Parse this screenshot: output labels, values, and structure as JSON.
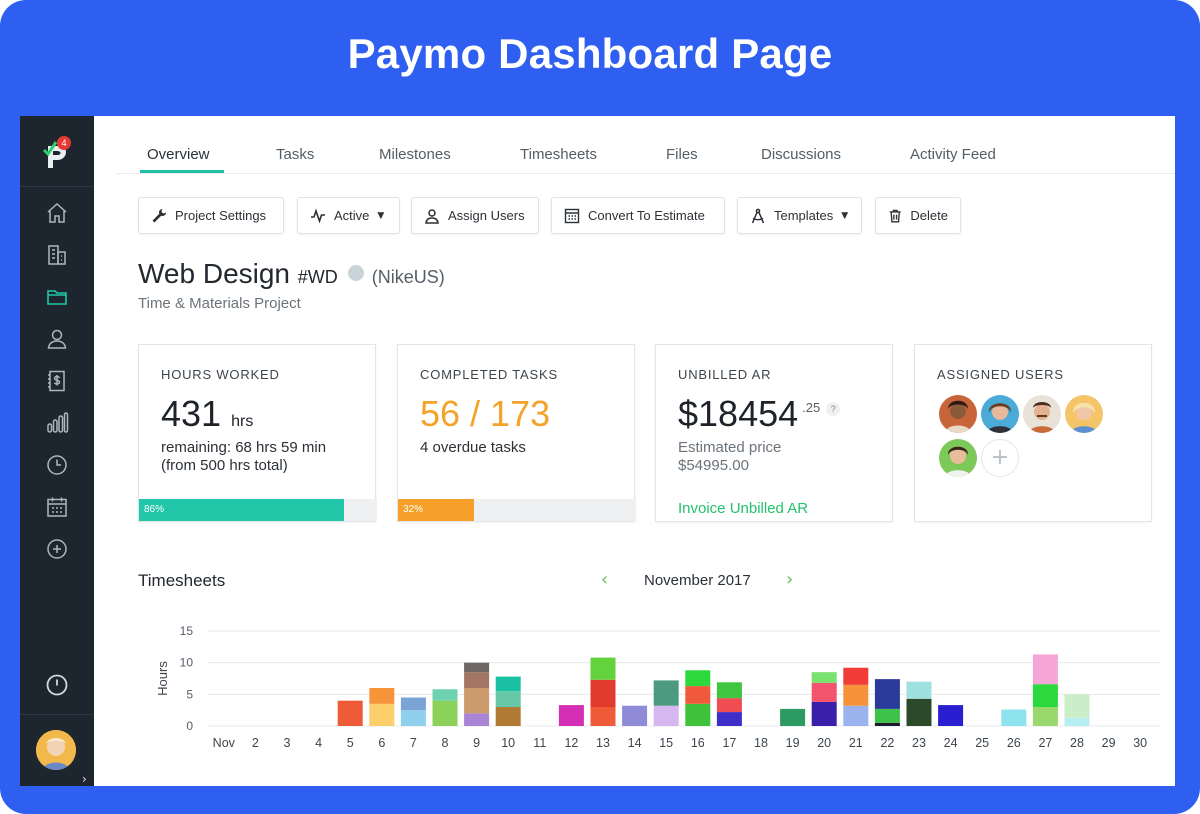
{
  "banner": {
    "title": "Paymo Dashboard Page"
  },
  "sidebar": {
    "badge_count": "4",
    "items": [
      {
        "name": "home-icon"
      },
      {
        "name": "clients-icon"
      },
      {
        "name": "projects-icon"
      },
      {
        "name": "users-icon"
      },
      {
        "name": "invoices-icon"
      },
      {
        "name": "reports-icon"
      },
      {
        "name": "time-icon"
      },
      {
        "name": "calendar-icon"
      },
      {
        "name": "add-icon"
      }
    ],
    "bottom_icon": "power-icon",
    "expand_label": "›"
  },
  "tabs": [
    {
      "label": "Overview",
      "active": true
    },
    {
      "label": "Tasks"
    },
    {
      "label": "Milestones"
    },
    {
      "label": "Timesheets"
    },
    {
      "label": "Files"
    },
    {
      "label": "Discussions"
    },
    {
      "label": "Activity Feed"
    }
  ],
  "toolbar": {
    "project_settings": "Project Settings",
    "active": "Active",
    "assign_users": "Assign Users",
    "convert_to_estimate": "Convert To Estimate",
    "templates": "Templates",
    "delete": "Delete"
  },
  "project": {
    "name": "Web Design",
    "code": "#WD",
    "client": "(NikeUS)",
    "type": "Time & Materials Project"
  },
  "cards": {
    "hours": {
      "label": "HOURS WORKED",
      "value": "431",
      "unit": "hrs",
      "remaining": "remaining: 68 hrs 59 min",
      "total": "(from 500 hrs total)",
      "progress_label": "86%",
      "progress": 0.86,
      "color": "#22c7a9"
    },
    "tasks": {
      "label": "COMPLETED TASKS",
      "value": "56 / 173",
      "overdue": "4 overdue tasks",
      "progress_label": "32%",
      "progress": 0.32,
      "color": "#f6a02a"
    },
    "unbilled": {
      "label": "UNBILLED AR",
      "value": "$18454",
      "cents": ".25",
      "help": "?",
      "estimated_label": "Estimated price",
      "estimated_value": "$54995.00",
      "link": "Invoice Unbilled AR"
    },
    "users": {
      "label": "ASSIGNED USERS",
      "add": "+"
    }
  },
  "timesheets": {
    "title": "Timesheets",
    "month": "November 2017",
    "prev": "‹",
    "next": "›"
  },
  "chart_data": {
    "type": "bar",
    "stacked": true,
    "ylabel": "Hours",
    "ylim": [
      0,
      15
    ],
    "yticks": [
      0,
      5,
      10,
      15
    ],
    "categories": [
      "Nov",
      "2",
      "3",
      "4",
      "5",
      "6",
      "7",
      "8",
      "9",
      "10",
      "11",
      "12",
      "13",
      "14",
      "15",
      "16",
      "17",
      "18",
      "19",
      "20",
      "21",
      "22",
      "23",
      "24",
      "25",
      "26",
      "27",
      "28",
      "29",
      "30"
    ],
    "stacks": [
      [],
      [],
      [],
      [],
      [
        {
          "v": 4,
          "c": "#ef5a38"
        }
      ],
      [
        {
          "v": 3.5,
          "c": "#fccf6b"
        },
        {
          "v": 2.5,
          "c": "#f7943a"
        }
      ],
      [
        {
          "v": 2.5,
          "c": "#8fd0ec"
        },
        {
          "v": 2,
          "c": "#7ba4d6"
        }
      ],
      [
        {
          "v": 4,
          "c": "#8cd25a"
        },
        {
          "v": 1.8,
          "c": "#6ed1b0"
        }
      ],
      [
        {
          "v": 2,
          "c": "#a983d6"
        },
        {
          "v": 4,
          "c": "#cd9a6b"
        },
        {
          "v": 2.5,
          "c": "#a27663"
        },
        {
          "v": 1.5,
          "c": "#6d6766"
        }
      ],
      [
        {
          "v": 3,
          "c": "#b07a34"
        },
        {
          "v": 2.5,
          "c": "#66c8a6"
        },
        {
          "v": 2.3,
          "c": "#19c0a4"
        }
      ],
      [],
      [
        {
          "v": 3.3,
          "c": "#d42fb4"
        }
      ],
      [
        {
          "v": 3,
          "c": "#ef5a38"
        },
        {
          "v": 4.3,
          "c": "#e03b2c"
        },
        {
          "v": 3.5,
          "c": "#64d23d"
        }
      ],
      [
        {
          "v": 3.2,
          "c": "#8f8bd6"
        }
      ],
      [
        {
          "v": 3.2,
          "c": "#d6b7f0"
        },
        {
          "v": 4,
          "c": "#4c9a80"
        }
      ],
      [
        {
          "v": 3.5,
          "c": "#40c33a"
        },
        {
          "v": 2.8,
          "c": "#f05a3a"
        },
        {
          "v": 2.5,
          "c": "#2bd93c"
        }
      ],
      [
        {
          "v": 2.2,
          "c": "#3e2fcb"
        },
        {
          "v": 2.2,
          "c": "#f04e52"
        },
        {
          "v": 2.5,
          "c": "#3fc540"
        }
      ],
      [],
      [
        {
          "v": 2.7,
          "c": "#2e9a63"
        }
      ],
      [
        {
          "v": 3.8,
          "c": "#3a1faa"
        },
        {
          "v": 3,
          "c": "#f2546d"
        },
        {
          "v": 1.7,
          "c": "#7ae26e"
        }
      ],
      [
        {
          "v": 3.2,
          "c": "#9bb4ef"
        },
        {
          "v": 3.3,
          "c": "#f7913a"
        },
        {
          "v": 2.7,
          "c": "#f23c36"
        }
      ],
      [
        {
          "v": 0.5,
          "c": "#1e1a2e"
        },
        {
          "v": 2.2,
          "c": "#3ec24a"
        },
        {
          "v": 4.7,
          "c": "#2a3a9a"
        }
      ],
      [
        {
          "v": 4.3,
          "c": "#2c4a2a"
        },
        {
          "v": 2.7,
          "c": "#9fe1de"
        }
      ],
      [
        {
          "v": 3.3,
          "c": "#2a1fd0"
        }
      ],
      [],
      [
        {
          "v": 2.6,
          "c": "#8ee2ee"
        }
      ],
      [
        {
          "v": 3,
          "c": "#9ad86e"
        },
        {
          "v": 3.6,
          "c": "#2bd93c"
        },
        {
          "v": 4.7,
          "c": "#f5a6d6"
        }
      ],
      [
        {
          "v": 1.3,
          "c": "#b7eef2"
        },
        {
          "v": 3.7,
          "c": "#cbeec9"
        }
      ],
      [],
      []
    ]
  }
}
